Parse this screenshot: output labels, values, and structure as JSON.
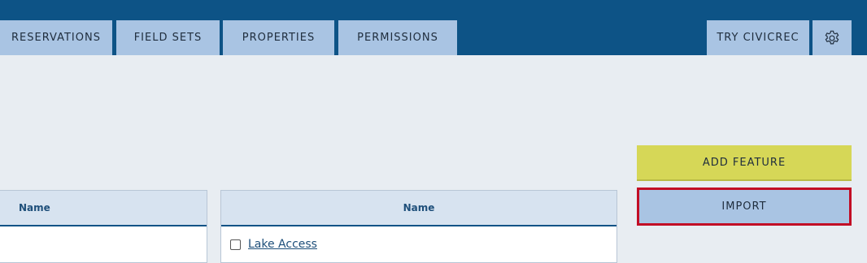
{
  "nav": {
    "tabs": [
      {
        "label": "RESERVATIONS"
      },
      {
        "label": "FIELD SETS"
      },
      {
        "label": "PROPERTIES"
      },
      {
        "label": "PERMISSIONS"
      }
    ],
    "try_label": "TRY CIVICREC",
    "settings_icon": "gear-icon"
  },
  "actions": {
    "add_label": "ADD FEATURE",
    "import_label": "IMPORT"
  },
  "left_table": {
    "header": "Name"
  },
  "right_table": {
    "header": "Name",
    "rows": [
      {
        "label": "Lake Access"
      }
    ]
  },
  "colors": {
    "nav_bg": "#0d5386",
    "tab_bg": "#a9c4e3",
    "add_btn": "#d6d757",
    "import_border": "#c20d25",
    "page_bg": "#e8edf2"
  }
}
